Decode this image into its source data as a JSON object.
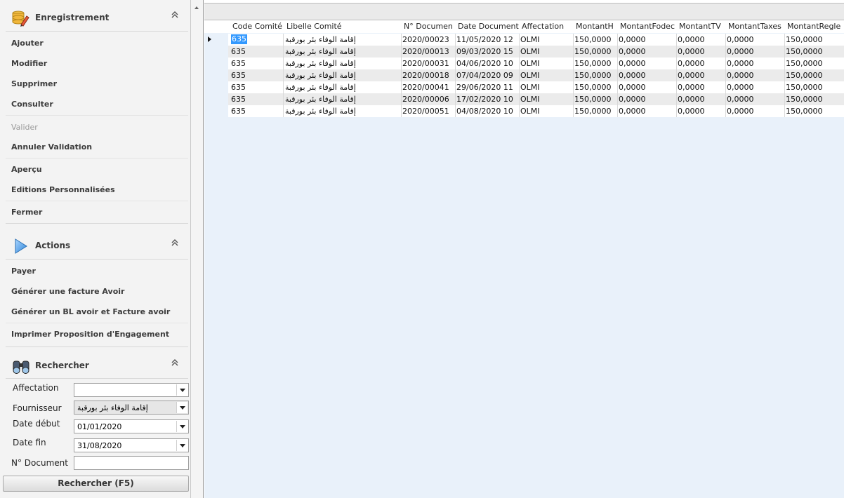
{
  "sidebar": {
    "enregistrement": {
      "title": "Enregistrement",
      "items": [
        "Ajouter",
        "Modifier",
        "Supprimer",
        "Consulter",
        "Valider",
        "Annuler Validation",
        "Aperçu",
        "Editions Personnalisées",
        "Fermer"
      ]
    },
    "actions": {
      "title": "Actions",
      "items": [
        "Payer",
        "Générer une facture Avoir",
        "Générer un BL avoir et Facture avoir",
        "Imprimer Proposition d'Engagement"
      ]
    },
    "rechercher": {
      "title": "Rechercher",
      "fields": {
        "affectation": {
          "label": "Affectation",
          "value": ""
        },
        "fournisseur": {
          "label": "Fournisseur",
          "value": "إقامة الوفاء بئر بورقبة"
        },
        "date_debut": {
          "label": "Date début",
          "value": "01/01/2020"
        },
        "date_fin": {
          "label": "Date fin",
          "value": "31/08/2020"
        },
        "num_document": {
          "label": "N° Document",
          "value": ""
        }
      },
      "button_label": "Rechercher (F5)"
    }
  },
  "grid": {
    "columns": [
      "Code Comité",
      "Libelle Comité",
      "N° Documen",
      "Date Document",
      "Affectation",
      "MontantH",
      "MontantFodec",
      "MontantTV",
      "MontantTaxes",
      "MontantRegle"
    ],
    "rows": [
      [
        "635",
        "إقامة الوفاء بئر بورقبة",
        "2020/00023",
        "11/05/2020 12",
        "OLMI",
        "150,0000",
        "0,0000",
        "0,0000",
        "0,0000",
        "150,0000"
      ],
      [
        "635",
        "إقامة الوفاء بئر بورقبة",
        "2020/00013",
        "09/03/2020 15",
        "OLMI",
        "150,0000",
        "0,0000",
        "0,0000",
        "0,0000",
        "150,0000"
      ],
      [
        "635",
        "إقامة الوفاء بئر بورقبة",
        "2020/00031",
        "04/06/2020 10",
        "OLMI",
        "150,0000",
        "0,0000",
        "0,0000",
        "0,0000",
        "150,0000"
      ],
      [
        "635",
        "إقامة الوفاء بئر بورقبة",
        "2020/00018",
        "07/04/2020 09",
        "OLMI",
        "150,0000",
        "0,0000",
        "0,0000",
        "0,0000",
        "150,0000"
      ],
      [
        "635",
        "إقامة الوفاء بئر بورقبة",
        "2020/00041",
        "29/06/2020 11",
        "OLMI",
        "150,0000",
        "0,0000",
        "0,0000",
        "0,0000",
        "150,0000"
      ],
      [
        "635",
        "إقامة الوفاء بئر بورقبة",
        "2020/00006",
        "17/02/2020 10",
        "OLMI",
        "150,0000",
        "0,0000",
        "0,0000",
        "0,0000",
        "150,0000"
      ],
      [
        "635",
        "إقامة الوفاء بئر بورقبة",
        "2020/00051",
        "04/08/2020 10",
        "OLMI",
        "150,0000",
        "0,0000",
        "0,0000",
        "0,0000",
        "150,0000"
      ]
    ],
    "selected_row": 0
  },
  "icons": {
    "enregistrement": "database-pencil-icon",
    "actions": "play-arrow-icon",
    "rechercher": "binoculars-icon",
    "collapse": "double-chevron-up-icon",
    "row_indicator": "row-pointer-icon"
  },
  "colors": {
    "selection": "#3399ff",
    "grid_background": "#e9f1fa",
    "panel_background": "#f3f3f3"
  }
}
